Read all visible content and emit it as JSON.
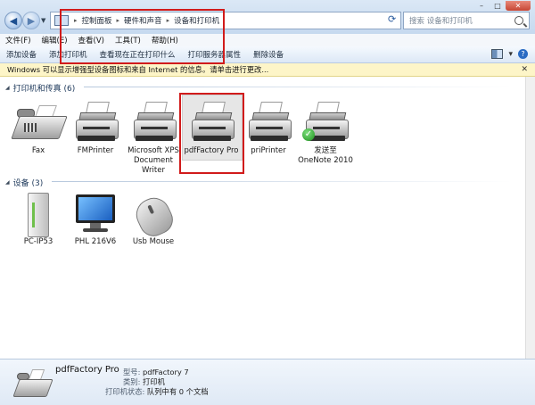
{
  "window": {
    "min": "–",
    "max": "□",
    "close": "✕"
  },
  "address": {
    "crumbs": [
      "控制面板",
      "硬件和声音",
      "设备和打印机"
    ],
    "search_placeholder": "搜索 设备和打印机"
  },
  "menu": [
    "文件(F)",
    "编辑(E)",
    "查看(V)",
    "工具(T)",
    "帮助(H)"
  ],
  "toolbar": [
    "添加设备",
    "添加打印机",
    "查看现在正在打印什么",
    "打印服务器属性",
    "删除设备"
  ],
  "infobar": {
    "text": "Windows 可以显示增强型设备图标和来自 Internet 的信息。请单击进行更改..."
  },
  "groups": {
    "printers": {
      "title": "打印机和传真 (6)",
      "items": [
        {
          "label": "Fax",
          "icon": "fax-icon"
        },
        {
          "label": "FMPrinter",
          "icon": "printer-icon"
        },
        {
          "label": "Microsoft XPS Document Writer",
          "icon": "printer-icon"
        },
        {
          "label": "pdfFactory Pro",
          "icon": "printer-icon"
        },
        {
          "label": "priPrinter",
          "icon": "printer-icon"
        },
        {
          "label": "发送至 OneNote 2010",
          "icon": "printer-default-icon"
        }
      ]
    },
    "devices": {
      "title": "设备 (3)",
      "items": [
        {
          "label": "PC-IP53",
          "icon": "computer-tower-icon"
        },
        {
          "label": "PHL 216V6",
          "icon": "monitor-icon"
        },
        {
          "label": "Usb Mouse",
          "icon": "mouse-icon"
        }
      ]
    }
  },
  "details": {
    "name": "pdfFactory Pro",
    "model_label": "型号:",
    "model_value": "pdfFactory 7",
    "category_label": "类别:",
    "category_value": "打印机",
    "status_label": "打印机状态:",
    "status_value": "队列中有 0 个文档"
  },
  "colors": {
    "annotation_red": "#d11b1b",
    "infobar_bg": "#fdf5c8",
    "group_header": "#1e395b"
  }
}
